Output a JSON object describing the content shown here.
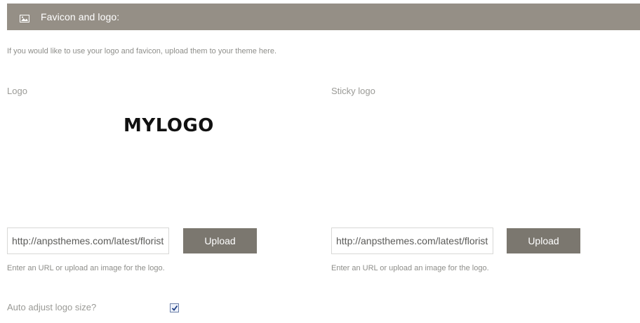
{
  "section": {
    "title": "Favicon and logo:",
    "icon": "image-icon",
    "intro": "If you would like to use your logo and favicon, upload them to your theme here."
  },
  "logo": {
    "label": "Logo",
    "preview_text": "MYLOGO",
    "url_value": "http://anpsthemes.com/latest/florist",
    "upload_label": "Upload",
    "hint": "Enter an URL or upload an image for the logo."
  },
  "sticky_logo": {
    "label": "Sticky logo",
    "url_value": "http://anpsthemes.com/latest/florist",
    "upload_label": "Upload",
    "hint": "Enter an URL or upload an image for the logo."
  },
  "auto_adjust": {
    "label": "Auto adjust logo size?",
    "checked": true
  },
  "colors": {
    "header_bg": "#958f86",
    "button_bg": "#7b776f",
    "text_muted": "#8e8e8a"
  }
}
